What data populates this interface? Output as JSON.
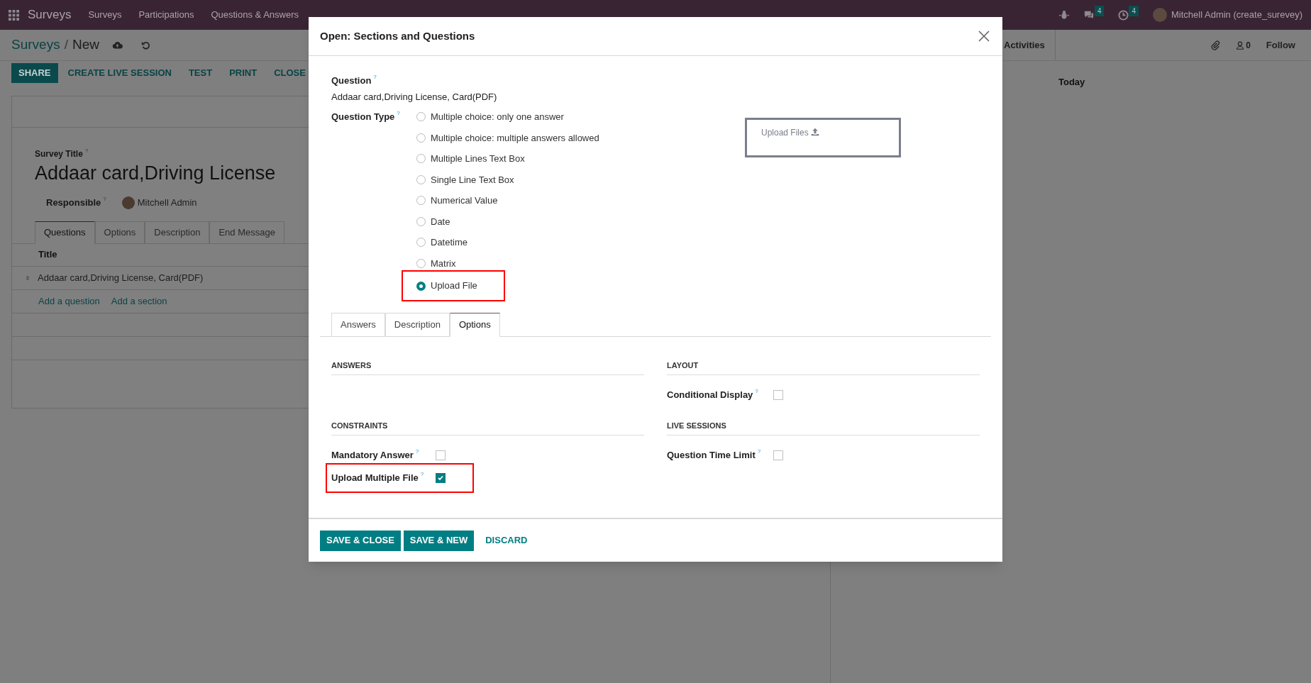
{
  "navbar": {
    "app_name": "Surveys",
    "menu": [
      {
        "label": "Surveys"
      },
      {
        "label": "Participations"
      },
      {
        "label": "Questions & Answers"
      }
    ],
    "messages_count": "4",
    "activities_count": "4",
    "user": "Mitchell Admin (create_surevey)"
  },
  "control_panel": {
    "breadcrumb": [
      {
        "label": "Surveys"
      },
      {
        "label": "New"
      }
    ],
    "separator": "/",
    "buttons": [
      {
        "label": "SHARE",
        "kind": "primary"
      },
      {
        "label": "CREATE LIVE SESSION",
        "kind": "link"
      },
      {
        "label": "TEST",
        "kind": "link"
      },
      {
        "label": "PRINT",
        "kind": "link"
      },
      {
        "label": "CLOSE",
        "kind": "link"
      }
    ]
  },
  "form": {
    "title_label": {
      "label": "Survey Title",
      "help": "?"
    },
    "title": "Addaar card,Driving License",
    "responsible_label": {
      "label": "Responsible",
      "help": "?"
    },
    "responsible": "Mitchell Admin",
    "tabs": [
      {
        "label": "Questions",
        "selected": true
      },
      {
        "label": "Options",
        "selected": false
      },
      {
        "label": "Description",
        "selected": false
      },
      {
        "label": "End Message",
        "selected": false
      }
    ],
    "table": {
      "columns": [
        "Title"
      ],
      "rows": [
        {
          "title": "Addaar card,Driving License, Card(PDF)"
        }
      ]
    },
    "links": [
      "Add a question",
      "Add a section"
    ]
  },
  "chatter": {
    "activities": "Activities",
    "followers_count": "0",
    "follow": "Follow",
    "date_separator": "Today"
  },
  "dialog": {
    "title": "Open: Sections and Questions",
    "question": {
      "label": "Question",
      "help": "?",
      "value": "Addaar card,Driving License, Card(PDF)"
    },
    "question_type": {
      "label": "Question Type",
      "help": "?",
      "options": [
        {
          "label": "Multiple choice: only one answer",
          "selected": false,
          "highlighted": false
        },
        {
          "label": "Multiple choice: multiple answers allowed",
          "selected": false,
          "highlighted": false
        },
        {
          "label": "Multiple Lines Text Box",
          "selected": false,
          "highlighted": false
        },
        {
          "label": "Single Line Text Box",
          "selected": false,
          "highlighted": false
        },
        {
          "label": "Numerical Value",
          "selected": false,
          "highlighted": false
        },
        {
          "label": "Date",
          "selected": false,
          "highlighted": false
        },
        {
          "label": "Datetime",
          "selected": false,
          "highlighted": false
        },
        {
          "label": "Matrix",
          "selected": false,
          "highlighted": false
        },
        {
          "label": "Upload File",
          "selected": true,
          "highlighted": true
        }
      ]
    },
    "upload_preview": {
      "label": "Upload Files"
    },
    "tabs": [
      {
        "label": "Answers",
        "selected": false
      },
      {
        "label": "Description",
        "selected": false
      },
      {
        "label": "Options",
        "selected": true
      }
    ],
    "columns": [
      [
        {
          "title": "ANSWERS"
        },
        {
          "title": "CONSTRAINTS",
          "fields": [
            {
              "label": "Mandatory Answer",
              "help": "?",
              "checked": false,
              "highlighted": false
            },
            {
              "label": "Upload Multiple File",
              "help": "?",
              "checked": true,
              "highlighted": true
            }
          ]
        }
      ],
      [
        {
          "title": "LAYOUT",
          "fields": [
            {
              "label": "Conditional Display",
              "help": "?",
              "checked": false,
              "highlighted": false
            }
          ]
        },
        {
          "title": "LIVE SESSIONS",
          "fields": [
            {
              "label": "Question Time Limit",
              "help": "?",
              "checked": false,
              "highlighted": false
            }
          ]
        }
      ]
    ],
    "footer_buttons": [
      {
        "label": "SAVE & CLOSE",
        "kind": "primary"
      },
      {
        "label": "SAVE & NEW",
        "kind": "primary"
      },
      {
        "label": "DISCARD",
        "kind": "link"
      }
    ]
  }
}
